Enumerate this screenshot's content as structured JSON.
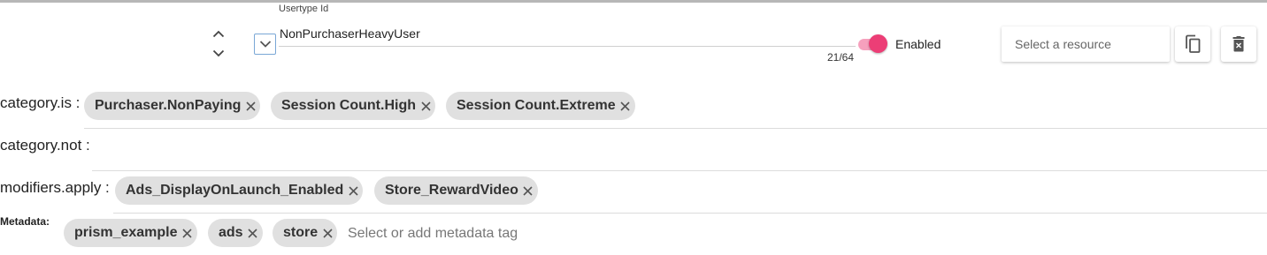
{
  "header": {
    "field_label": "Usertype Id",
    "field_value": "NonPurchaserHeavyUser",
    "char_counter": "21/64",
    "enabled": true,
    "enabled_label": "Enabled",
    "resource_placeholder": "Select a resource",
    "icons": {
      "move_up": "chevron-up-icon",
      "move_down": "chevron-down-icon",
      "expand": "chevron-down-icon",
      "copy": "copy-icon",
      "delete": "delete-icon"
    }
  },
  "rows": {
    "category_is": {
      "label": "category.is :",
      "chips": [
        "Purchaser.NonPaying",
        "Session Count.High",
        "Session Count.Extreme"
      ]
    },
    "category_not": {
      "label": "category.not :",
      "chips": []
    },
    "modifiers_apply": {
      "label": "modifiers.apply :",
      "chips": [
        "Ads_DisplayOnLaunch_Enabled",
        "Store_RewardVideo"
      ]
    },
    "metadata": {
      "label": "Metadata:",
      "chips": [
        "prism_example",
        "ads",
        "store"
      ],
      "input_placeholder": "Select or add metadata tag"
    }
  },
  "colors": {
    "accent": "#ec3e76",
    "accent_track": "#f6a0bd",
    "chip_bg": "#e0e0e0",
    "focus_border": "#7aa7d6"
  }
}
